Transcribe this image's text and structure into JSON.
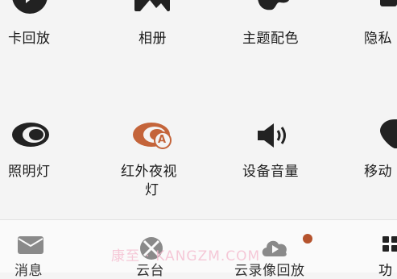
{
  "grid": {
    "row1": {
      "playback_label": "卡回放",
      "album_label": "相册",
      "theme_label": "主题配色",
      "privacy_label": "隐私"
    },
    "row2": {
      "light_label": "照明灯",
      "ir_light_label_1": "红外夜视",
      "ir_light_label_2": "灯",
      "ir_icon_letter": "A",
      "volume_label": "设备音量",
      "motion_label": "移动"
    }
  },
  "tabbar": {
    "messages_label": "消息",
    "ptz_label": "云台",
    "cloud_playback_label": "云录像回放",
    "functions_label": "功"
  },
  "watermark": "康至 · KANGZM.COM",
  "colors": {
    "accent": "#c4643a",
    "dot": "#b5532d",
    "icon_dark": "#222222",
    "icon_gray": "#8a8a8a"
  }
}
